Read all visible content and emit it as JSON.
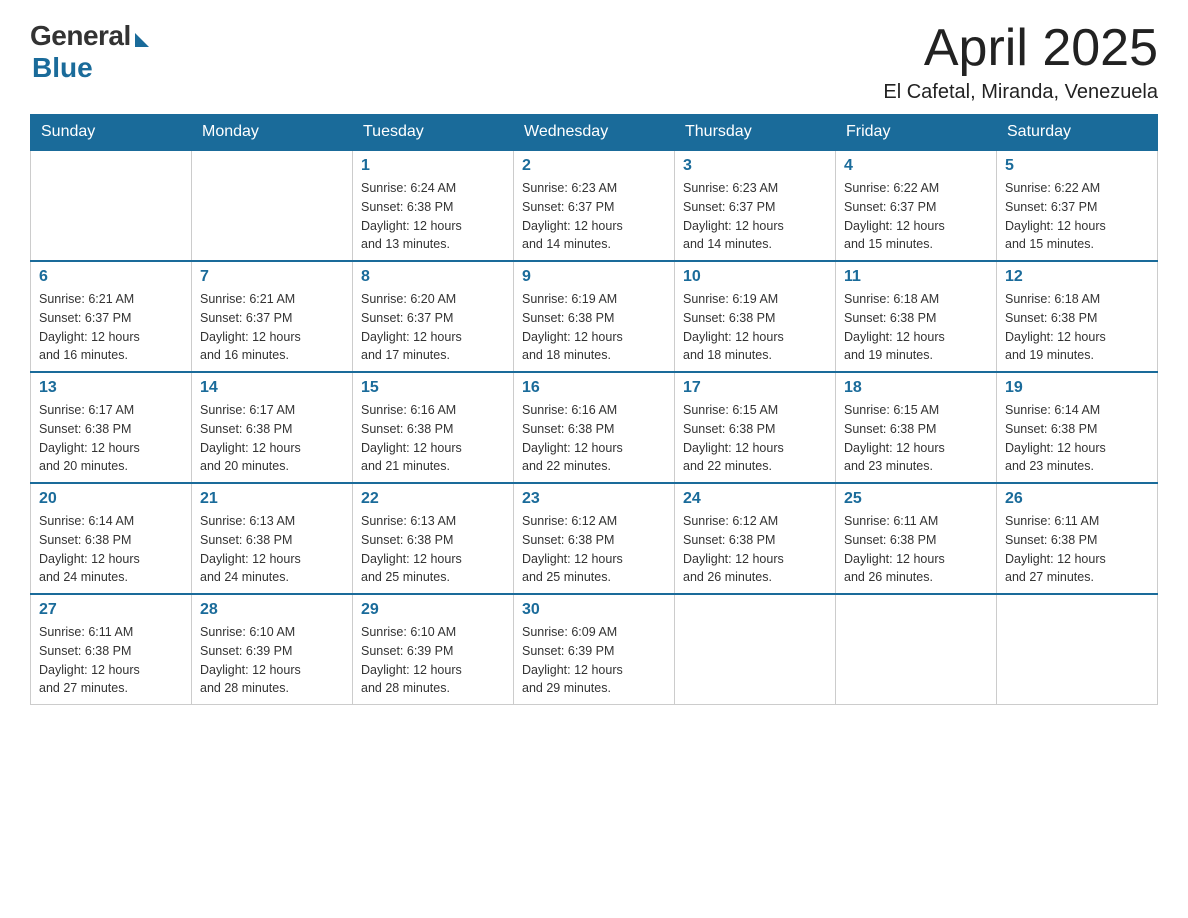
{
  "logo": {
    "general": "General",
    "blue": "Blue"
  },
  "title": "April 2025",
  "location": "El Cafetal, Miranda, Venezuela",
  "days_of_week": [
    "Sunday",
    "Monday",
    "Tuesday",
    "Wednesday",
    "Thursday",
    "Friday",
    "Saturday"
  ],
  "weeks": [
    [
      {
        "day": "",
        "info": ""
      },
      {
        "day": "",
        "info": ""
      },
      {
        "day": "1",
        "info": "Sunrise: 6:24 AM\nSunset: 6:38 PM\nDaylight: 12 hours\nand 13 minutes."
      },
      {
        "day": "2",
        "info": "Sunrise: 6:23 AM\nSunset: 6:37 PM\nDaylight: 12 hours\nand 14 minutes."
      },
      {
        "day": "3",
        "info": "Sunrise: 6:23 AM\nSunset: 6:37 PM\nDaylight: 12 hours\nand 14 minutes."
      },
      {
        "day": "4",
        "info": "Sunrise: 6:22 AM\nSunset: 6:37 PM\nDaylight: 12 hours\nand 15 minutes."
      },
      {
        "day": "5",
        "info": "Sunrise: 6:22 AM\nSunset: 6:37 PM\nDaylight: 12 hours\nand 15 minutes."
      }
    ],
    [
      {
        "day": "6",
        "info": "Sunrise: 6:21 AM\nSunset: 6:37 PM\nDaylight: 12 hours\nand 16 minutes."
      },
      {
        "day": "7",
        "info": "Sunrise: 6:21 AM\nSunset: 6:37 PM\nDaylight: 12 hours\nand 16 minutes."
      },
      {
        "day": "8",
        "info": "Sunrise: 6:20 AM\nSunset: 6:37 PM\nDaylight: 12 hours\nand 17 minutes."
      },
      {
        "day": "9",
        "info": "Sunrise: 6:19 AM\nSunset: 6:38 PM\nDaylight: 12 hours\nand 18 minutes."
      },
      {
        "day": "10",
        "info": "Sunrise: 6:19 AM\nSunset: 6:38 PM\nDaylight: 12 hours\nand 18 minutes."
      },
      {
        "day": "11",
        "info": "Sunrise: 6:18 AM\nSunset: 6:38 PM\nDaylight: 12 hours\nand 19 minutes."
      },
      {
        "day": "12",
        "info": "Sunrise: 6:18 AM\nSunset: 6:38 PM\nDaylight: 12 hours\nand 19 minutes."
      }
    ],
    [
      {
        "day": "13",
        "info": "Sunrise: 6:17 AM\nSunset: 6:38 PM\nDaylight: 12 hours\nand 20 minutes."
      },
      {
        "day": "14",
        "info": "Sunrise: 6:17 AM\nSunset: 6:38 PM\nDaylight: 12 hours\nand 20 minutes."
      },
      {
        "day": "15",
        "info": "Sunrise: 6:16 AM\nSunset: 6:38 PM\nDaylight: 12 hours\nand 21 minutes."
      },
      {
        "day": "16",
        "info": "Sunrise: 6:16 AM\nSunset: 6:38 PM\nDaylight: 12 hours\nand 22 minutes."
      },
      {
        "day": "17",
        "info": "Sunrise: 6:15 AM\nSunset: 6:38 PM\nDaylight: 12 hours\nand 22 minutes."
      },
      {
        "day": "18",
        "info": "Sunrise: 6:15 AM\nSunset: 6:38 PM\nDaylight: 12 hours\nand 23 minutes."
      },
      {
        "day": "19",
        "info": "Sunrise: 6:14 AM\nSunset: 6:38 PM\nDaylight: 12 hours\nand 23 minutes."
      }
    ],
    [
      {
        "day": "20",
        "info": "Sunrise: 6:14 AM\nSunset: 6:38 PM\nDaylight: 12 hours\nand 24 minutes."
      },
      {
        "day": "21",
        "info": "Sunrise: 6:13 AM\nSunset: 6:38 PM\nDaylight: 12 hours\nand 24 minutes."
      },
      {
        "day": "22",
        "info": "Sunrise: 6:13 AM\nSunset: 6:38 PM\nDaylight: 12 hours\nand 25 minutes."
      },
      {
        "day": "23",
        "info": "Sunrise: 6:12 AM\nSunset: 6:38 PM\nDaylight: 12 hours\nand 25 minutes."
      },
      {
        "day": "24",
        "info": "Sunrise: 6:12 AM\nSunset: 6:38 PM\nDaylight: 12 hours\nand 26 minutes."
      },
      {
        "day": "25",
        "info": "Sunrise: 6:11 AM\nSunset: 6:38 PM\nDaylight: 12 hours\nand 26 minutes."
      },
      {
        "day": "26",
        "info": "Sunrise: 6:11 AM\nSunset: 6:38 PM\nDaylight: 12 hours\nand 27 minutes."
      }
    ],
    [
      {
        "day": "27",
        "info": "Sunrise: 6:11 AM\nSunset: 6:38 PM\nDaylight: 12 hours\nand 27 minutes."
      },
      {
        "day": "28",
        "info": "Sunrise: 6:10 AM\nSunset: 6:39 PM\nDaylight: 12 hours\nand 28 minutes."
      },
      {
        "day": "29",
        "info": "Sunrise: 6:10 AM\nSunset: 6:39 PM\nDaylight: 12 hours\nand 28 minutes."
      },
      {
        "day": "30",
        "info": "Sunrise: 6:09 AM\nSunset: 6:39 PM\nDaylight: 12 hours\nand 29 minutes."
      },
      {
        "day": "",
        "info": ""
      },
      {
        "day": "",
        "info": ""
      },
      {
        "day": "",
        "info": ""
      }
    ]
  ]
}
